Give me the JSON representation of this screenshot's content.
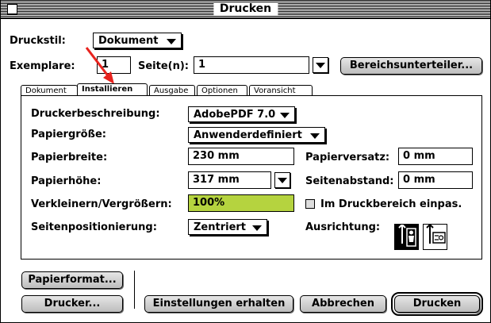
{
  "window": {
    "title": "Drucken"
  },
  "top": {
    "druckstil_label": "Druckstil:",
    "druckstil_value": "Dokument",
    "exemplare_label": "Exemplare:",
    "exemplare_value": "1",
    "seiten_label": "Seite(n):",
    "seiten_value": "1",
    "bereich_button": "Bereichsunterteiler..."
  },
  "tabs": [
    {
      "label": "Dokument"
    },
    {
      "label": "Installieren"
    },
    {
      "label": "Ausgabe"
    },
    {
      "label": "Optionen"
    },
    {
      "label": "Voransicht"
    }
  ],
  "panel": {
    "druckerbeschreibung_label": "Druckerbeschreibung:",
    "druckerbeschreibung_value": "AdobePDF 7.0",
    "papiergroesse_label": "Papiergröße:",
    "papiergroesse_value": "Anwenderdefiniert",
    "papierbreite_label": "Papierbreite:",
    "papierbreite_value": "230 mm",
    "papierhoehe_label": "Papierhöhe:",
    "papierhoehe_value": "317 mm",
    "papierversatz_label": "Papierversatz:",
    "papierversatz_value": "0 mm",
    "seitenabstand_label": "Seitenabstand:",
    "seitenabstand_value": "0 mm",
    "skalierung_label": "Verkleinern/Vergrößern:",
    "skalierung_value": "100%",
    "einpassen_label": "Im Druckbereich einpas.",
    "seitenpos_label": "Seitenpositionierung:",
    "seitenpos_value": "Zentriert",
    "ausrichtung_label": "Ausrichtung:"
  },
  "bottom": {
    "papierformat_button": "Papierformat...",
    "drucker_button": "Drucker...",
    "einstellungen_button": "Einstellungen erhalten",
    "abbrechen_button": "Abbrechen",
    "drucken_button": "Drucken"
  },
  "colors": {
    "highlight_field": "#b5d33f",
    "annotation_arrow": "#e8231e"
  },
  "icons": {
    "portrait": "portrait-orientation-icon",
    "landscape": "landscape-orientation-icon"
  }
}
